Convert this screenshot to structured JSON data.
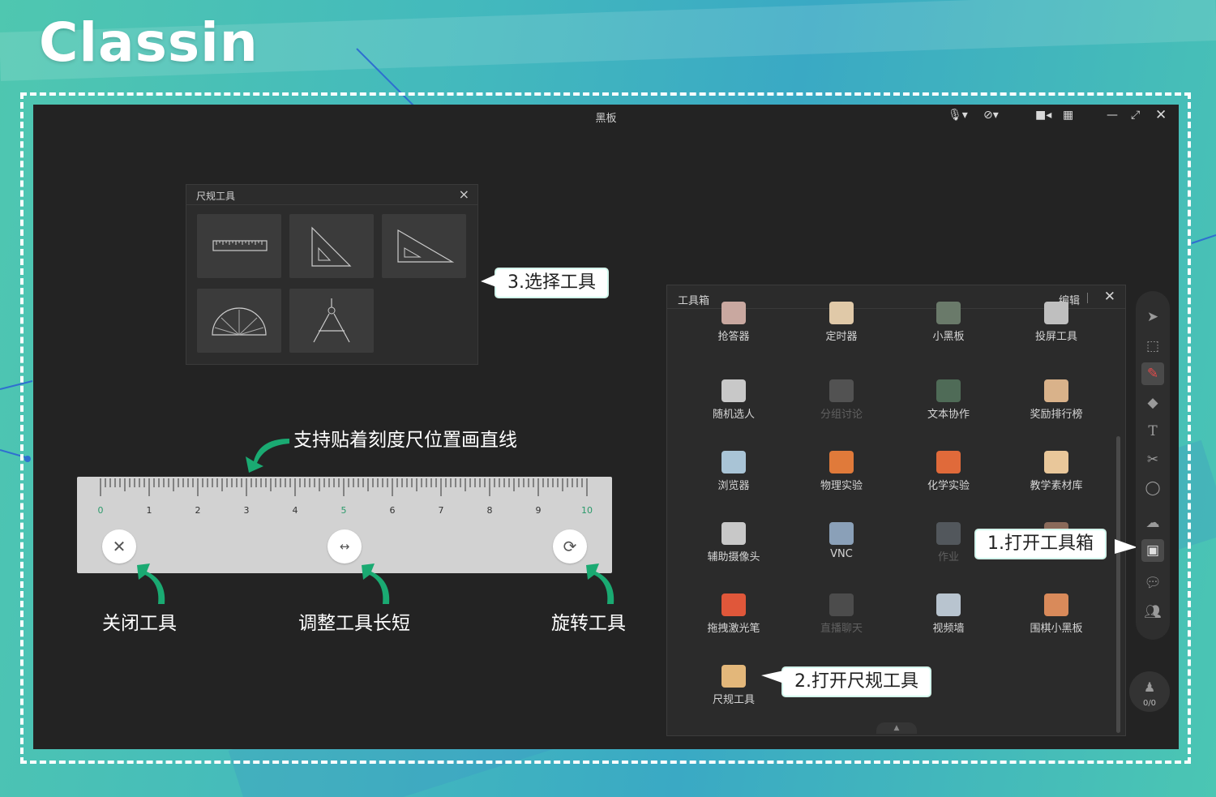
{
  "brand": {
    "logo_text": "Classin"
  },
  "window": {
    "title": "黑板"
  },
  "ruler_panel": {
    "title": "尺规工具",
    "tools": [
      "ruler-icon",
      "set-square-45-icon",
      "set-square-30-icon",
      "protractor-icon",
      "compass-icon"
    ]
  },
  "ruler": {
    "labels": [
      "0",
      "1",
      "2",
      "3",
      "4",
      "5",
      "6",
      "7",
      "8",
      "9",
      "10"
    ],
    "highlight_labels": [
      "0",
      "5",
      "10"
    ]
  },
  "annotations": {
    "step3": "3.选择工具",
    "step1": "1.打开工具箱",
    "step2": "2.打开尺规工具",
    "draw_line": "支持贴着刻度尺位置画直线",
    "close_tool": "关闭工具",
    "resize_tool": "调整工具长短",
    "rotate_tool": "旋转工具"
  },
  "toolbox": {
    "title": "工具箱",
    "edit_label": "编辑",
    "items": [
      {
        "label": "抢答器",
        "icon": "buzzer-icon",
        "color": "#c9a8a0",
        "enabled": true
      },
      {
        "label": "定时器",
        "icon": "hourglass-icon",
        "color": "#e0c9a8",
        "enabled": true
      },
      {
        "label": "小黑板",
        "icon": "small-blackboard-icon",
        "color": "#6a7a6a",
        "enabled": true
      },
      {
        "label": "投屏工具",
        "icon": "screen-cast-icon",
        "color": "#bfbfbf",
        "enabled": true
      },
      {
        "label": "随机选人",
        "icon": "random-pick-icon",
        "color": "#c8c8c8",
        "enabled": true
      },
      {
        "label": "分组讨论",
        "icon": "group-discussion-icon",
        "color": "#9a9a9a",
        "enabled": false
      },
      {
        "label": "文本协作",
        "icon": "text-collab-icon",
        "color": "#4f6b57",
        "enabled": true
      },
      {
        "label": "奖励排行榜",
        "icon": "leaderboard-icon",
        "color": "#d9b28a",
        "enabled": true
      },
      {
        "label": "浏览器",
        "icon": "browser-icon",
        "color": "#a9c4d6",
        "enabled": true
      },
      {
        "label": "物理实验",
        "icon": "magnet-icon",
        "color": "#e07a3a",
        "enabled": true
      },
      {
        "label": "化学实验",
        "icon": "flask-icon",
        "color": "#e06a3a",
        "enabled": true
      },
      {
        "label": "教学素材库",
        "icon": "material-library-icon",
        "color": "#e9c79a",
        "enabled": true
      },
      {
        "label": "辅助摄像头",
        "icon": "webcam-icon",
        "color": "#c8c8c8",
        "enabled": true
      },
      {
        "label": "VNC",
        "icon": "vnc-icon",
        "color": "#8aa0b8",
        "enabled": true
      },
      {
        "label": "作业",
        "icon": "homework-icon",
        "color": "#9aa9b8",
        "enabled": false
      },
      {
        "label": "",
        "icon": "hidden-tool-icon",
        "color": "#8a6a5a",
        "enabled": true
      },
      {
        "label": "拖拽激光笔",
        "icon": "laser-pointer-icon",
        "color": "#e0573a",
        "enabled": true
      },
      {
        "label": "直播聊天",
        "icon": "live-chat-icon",
        "color": "#8a8a8a",
        "enabled": false
      },
      {
        "label": "视频墙",
        "icon": "video-wall-icon",
        "color": "#b8c4cf",
        "enabled": true
      },
      {
        "label": "围棋小黑板",
        "icon": "go-board-icon",
        "color": "#d98a5a",
        "enabled": true
      },
      {
        "label": "尺规工具",
        "icon": "ruler-triangle-icon",
        "color": "#e3b77a",
        "enabled": true
      }
    ]
  },
  "right_toolbar": {
    "seat_count": "0/0"
  }
}
